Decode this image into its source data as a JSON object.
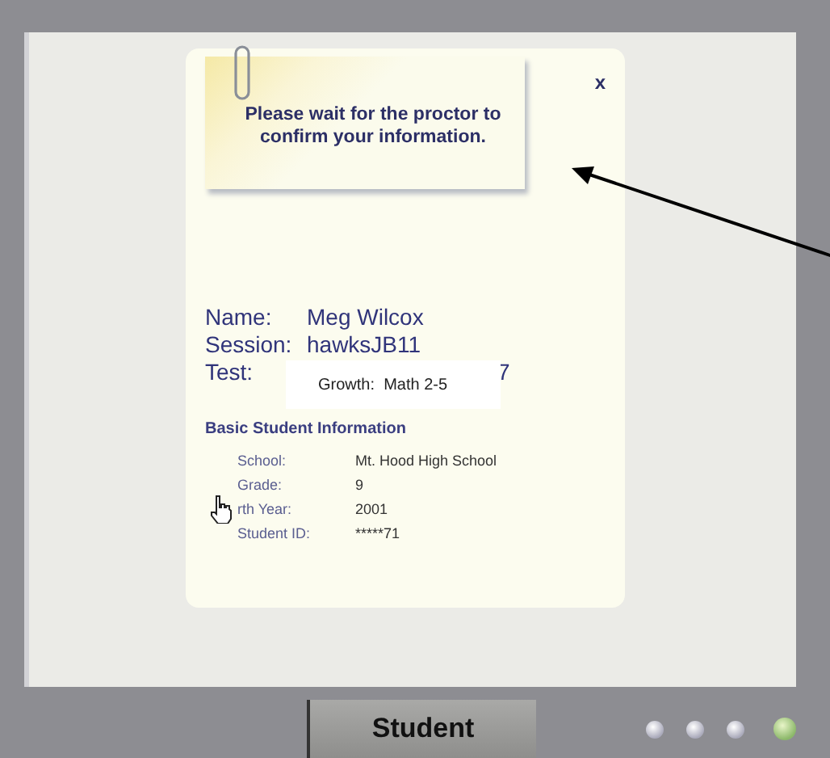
{
  "dialog": {
    "message": "Please wait for the proctor to confirm your information.",
    "close": "x",
    "fields": [
      {
        "label": "Name:",
        "value": "Meg Wilcox"
      },
      {
        "label": "Session:",
        "value": "hawksJB11"
      },
      {
        "label": "Test:",
        "value": "7",
        "overlay": "Growth:  Math 2-5"
      }
    ],
    "section_title": "Basic Student Information",
    "info": [
      {
        "label": "School:",
        "value": "Mt. Hood High School"
      },
      {
        "label": "Grade:",
        "value": "9"
      },
      {
        "label": "rth Year:",
        "value": "2001"
      },
      {
        "label": "Student ID:",
        "value": "*****71"
      }
    ]
  },
  "bottom_bar": {
    "tab": "Student",
    "lights": [
      {
        "kind": "plain"
      },
      {
        "kind": "plain"
      },
      {
        "kind": "plain"
      },
      {
        "kind": "power"
      }
    ]
  }
}
